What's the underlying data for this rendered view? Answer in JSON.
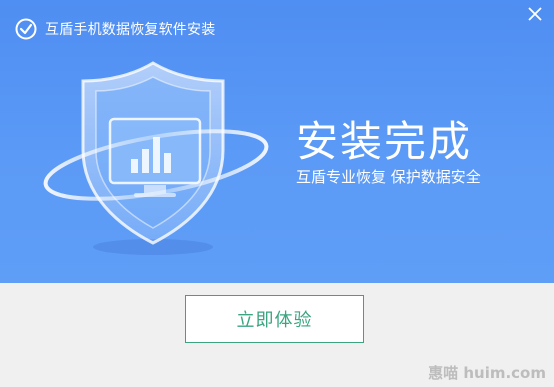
{
  "window": {
    "title": "互盾手机数据恢复软件安装",
    "close_symbol": "✕"
  },
  "banner": {
    "headline": "安装完成",
    "tagline": "互盾专业恢复  保护数据安全",
    "background_color": "#5b9af6"
  },
  "footer": {
    "button_label": "立即体验",
    "button_color": "#3ba480",
    "background_color": "#f0f0f0"
  },
  "watermark": {
    "text": "惠喵 huim.com"
  },
  "icons": {
    "app_logo": "app-logo-icon",
    "close": "close-icon",
    "shield": "shield-icon",
    "monitor": "monitor-chart-icon"
  }
}
